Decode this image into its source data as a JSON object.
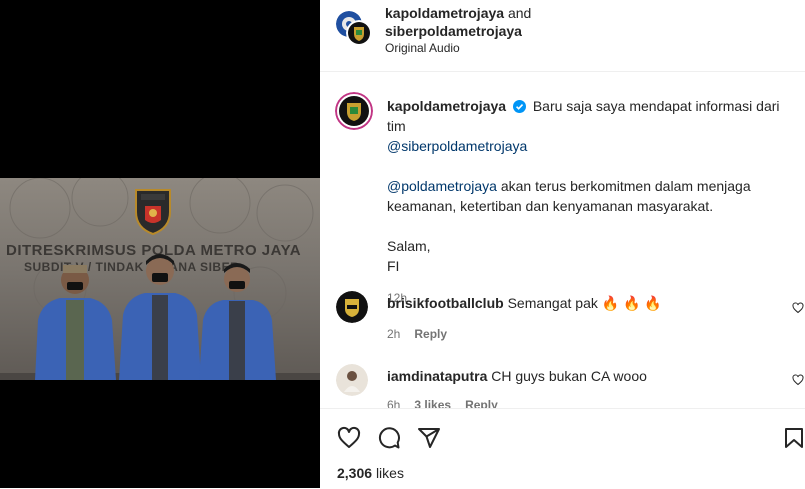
{
  "header": {
    "user1": "kapoldametrojaya",
    "connector": "and",
    "user2": "siberpoldametrojaya",
    "audio": "Original Audio"
  },
  "media": {
    "wall_text_line1": "DITRESKRIMSUS POLDA METRO JAYA",
    "wall_text_line2": "SUBDIT V / TINDAK PIDANA SIBER",
    "badge_text": "POLDA METRO JAYA"
  },
  "caption": {
    "username": "kapoldametrojaya",
    "text1": "Baru saja saya mendapat informasi dari tim",
    "mention1": "@siberpoldametrojaya",
    "mention2": "@poldametrojaya",
    "text2": "akan terus berkomitmen dalam menjaga keamanan, ketertiban dan kenyamanan masyarakat.",
    "salam": "Salam,",
    "sign": "FI",
    "time": "12h"
  },
  "comments": [
    {
      "username": "brisikfootballclub",
      "text": "Semangat pak 🔥 🔥 🔥",
      "time": "2h",
      "reply": "Reply"
    },
    {
      "username": "iamdinataputra",
      "text": "CH guys bukan CA wooo",
      "time": "6h",
      "likes": "3 likes",
      "reply": "Reply"
    }
  ],
  "post": {
    "likes_count": "2,306",
    "likes_label": "likes"
  },
  "colors": {
    "verified": "#0095f6",
    "link": "#00376b",
    "jacket": "#3b63b5"
  },
  "icons": [
    "heart-icon",
    "comment-icon",
    "share-icon",
    "bookmark-icon",
    "verified-icon"
  ]
}
